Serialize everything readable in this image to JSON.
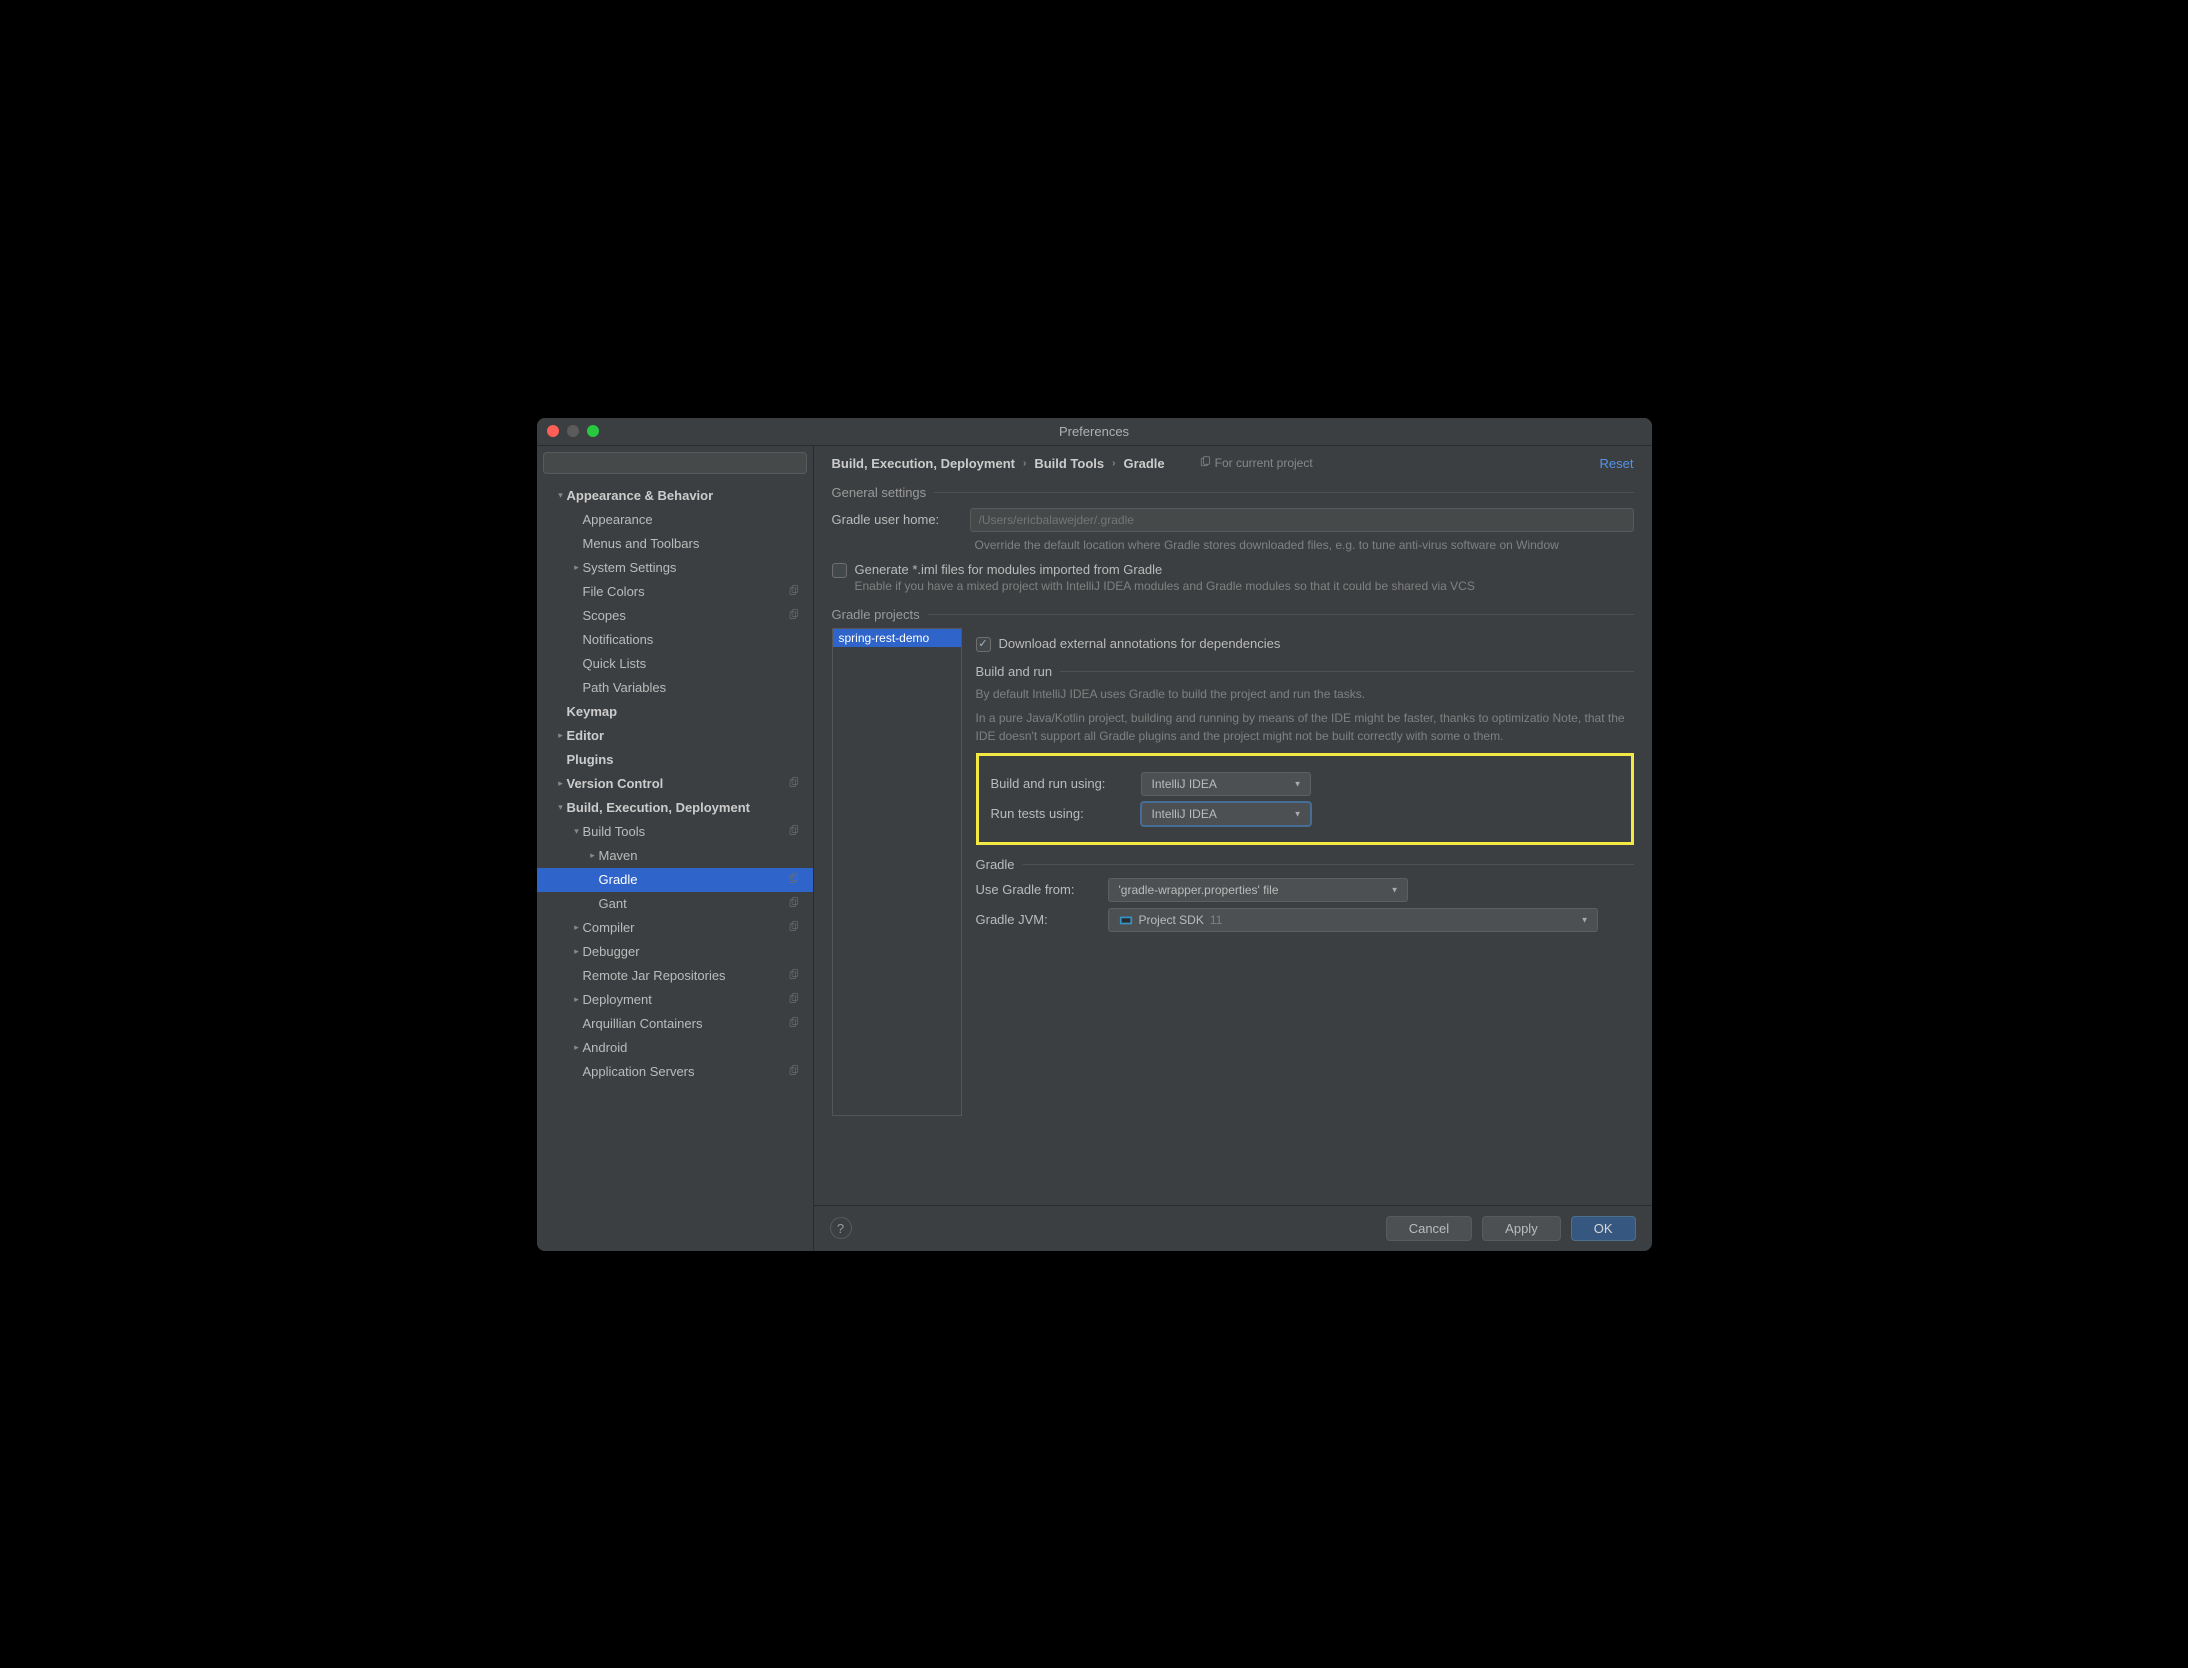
{
  "window": {
    "title": "Preferences"
  },
  "search": {
    "placeholder": ""
  },
  "sidebar": {
    "items": [
      {
        "label": "Appearance & Behavior",
        "arrow": "down",
        "bold": true,
        "ind": 1
      },
      {
        "label": "Appearance",
        "ind": 2
      },
      {
        "label": "Menus and Toolbars",
        "ind": 2
      },
      {
        "label": "System Settings",
        "arrow": "right",
        "ind": 2
      },
      {
        "label": "File Colors",
        "ind": 2,
        "copy": true
      },
      {
        "label": "Scopes",
        "ind": 2,
        "copy": true
      },
      {
        "label": "Notifications",
        "ind": 2
      },
      {
        "label": "Quick Lists",
        "ind": 2
      },
      {
        "label": "Path Variables",
        "ind": 2
      },
      {
        "label": "Keymap",
        "bold": true,
        "ind": 1
      },
      {
        "label": "Editor",
        "arrow": "right",
        "bold": true,
        "ind": 1
      },
      {
        "label": "Plugins",
        "bold": true,
        "ind": 1
      },
      {
        "label": "Version Control",
        "arrow": "right",
        "bold": true,
        "ind": 1,
        "copy": true
      },
      {
        "label": "Build, Execution, Deployment",
        "arrow": "down",
        "bold": true,
        "ind": 1
      },
      {
        "label": "Build Tools",
        "arrow": "down",
        "ind": 2,
        "copy": true
      },
      {
        "label": "Maven",
        "arrow": "right",
        "ind": 3
      },
      {
        "label": "Gradle",
        "ind": 3,
        "selected": true,
        "copy": true
      },
      {
        "label": "Gant",
        "ind": 3,
        "copy": true
      },
      {
        "label": "Compiler",
        "arrow": "right",
        "ind": 2,
        "copy": true
      },
      {
        "label": "Debugger",
        "arrow": "right",
        "ind": 2
      },
      {
        "label": "Remote Jar Repositories",
        "ind": 2,
        "copy": true
      },
      {
        "label": "Deployment",
        "arrow": "right",
        "ind": 2,
        "copy": true
      },
      {
        "label": "Arquillian Containers",
        "ind": 2,
        "copy": true
      },
      {
        "label": "Android",
        "arrow": "right",
        "ind": 2
      },
      {
        "label": "Application Servers",
        "ind": 2,
        "copy": true
      }
    ]
  },
  "breadcrumb": {
    "parts": [
      "Build, Execution, Deployment",
      "Build Tools",
      "Gradle"
    ]
  },
  "scope_label": "For current project",
  "reset_label": "Reset",
  "general": {
    "title": "General settings",
    "home_label": "Gradle user home:",
    "home_placeholder": "/Users/ericbalawejder/.gradle",
    "home_hint": "Override the default location where Gradle stores downloaded files, e.g. to tune anti-virus software on Window",
    "iml_label": "Generate *.iml files for modules imported from Gradle",
    "iml_hint": "Enable if you have a mixed project with IntelliJ IDEA modules and Gradle modules so that it could be shared via VCS"
  },
  "projects": {
    "title": "Gradle projects",
    "selected": "spring-rest-demo",
    "download_label": "Download external annotations for dependencies",
    "build_run_title": "Build and run",
    "desc1": "By default IntelliJ IDEA uses Gradle to build the project and run the tasks.",
    "desc2": "In a pure Java/Kotlin project, building and running by means of the IDE might be faster, thanks to optimizatio Note, that the IDE doesn't support all Gradle plugins and the project might not be built correctly with some o them.",
    "build_using_label": "Build and run using:",
    "build_using_value": "IntelliJ IDEA",
    "tests_using_label": "Run tests using:",
    "tests_using_value": "IntelliJ IDEA",
    "gradle_title": "Gradle",
    "use_from_label": "Use Gradle from:",
    "use_from_value": "'gradle-wrapper.properties' file",
    "jvm_label": "Gradle JVM:",
    "jvm_value": "Project SDK",
    "jvm_version": "11"
  },
  "footer": {
    "cancel": "Cancel",
    "apply": "Apply",
    "ok": "OK"
  }
}
